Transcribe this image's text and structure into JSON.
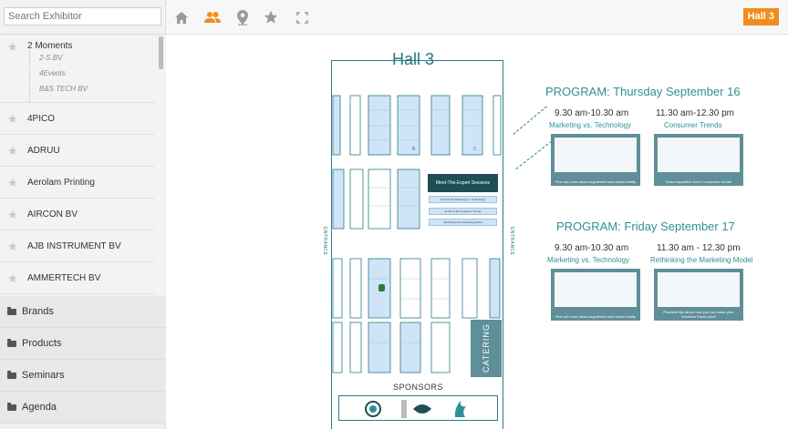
{
  "search": {
    "placeholder": "Search Exhibitor"
  },
  "exhibitors": [
    {
      "name": "2 Moments",
      "brands": [
        "2-S BV",
        "4Events",
        "B&S TECH BV"
      ]
    },
    {
      "name": "4PICO"
    },
    {
      "name": "ADRUU"
    },
    {
      "name": "Aerolam Printing"
    },
    {
      "name": "AIRCON BV"
    },
    {
      "name": "AJB INSTRUMENT BV"
    },
    {
      "name": "AMMERTECH BV"
    }
  ],
  "categories": [
    "Brands",
    "Products",
    "Seminars",
    "Agenda"
  ],
  "toolbar": {
    "icons": [
      "home-icon",
      "people-icon",
      "map-pin-icon",
      "star-icon",
      "fullscreen-icon"
    ],
    "active_icon": "people-icon",
    "hall_badge": "Hall 3"
  },
  "colors": {
    "accent": "#f28c1c",
    "teal": "#2f8f99",
    "card": "#5f8f98",
    "dark": "#1f4e57",
    "booth_blue": "#cfe4f6"
  },
  "map": {
    "title": "Hall 3",
    "meet_label": "Meet-The-Expert Sessions",
    "sessions": [
      "9.30-10.30 Marketing vs. Technology",
      "11.30-12.30 Consumer Trends",
      "Rethinking the Marketing Model"
    ],
    "entrance_left": "ENTRANCE",
    "entrance_right": "ENTRANCE",
    "catering": "CATERING",
    "sponsors": "SPONSORS",
    "booth_letters": [
      "B",
      "C"
    ]
  },
  "program": [
    {
      "title": "PROGRAM: Thursday September 16",
      "slots": [
        {
          "time": "9.30 am-10.30 am",
          "topic": "Marketing vs. Technology",
          "caption": "Find out more about augmented and virtual reality"
        },
        {
          "time": "11.30 am-12.30 pm",
          "topic": "Consumer Trends",
          "caption": "Draw inspiration from 4 consumer trends"
        }
      ]
    },
    {
      "title": "PROGRAM: Friday September 17",
      "slots": [
        {
          "time": "9.30 am-10.30 am",
          "topic": "Marketing vs. Technology",
          "caption": "Find out more about augmented and virtual reality"
        },
        {
          "time": "11.30 am - 12.30 pm",
          "topic": "Rethinking the Marketing Model",
          "caption": "Practical tips about how you can make your business future proof"
        }
      ]
    }
  ]
}
